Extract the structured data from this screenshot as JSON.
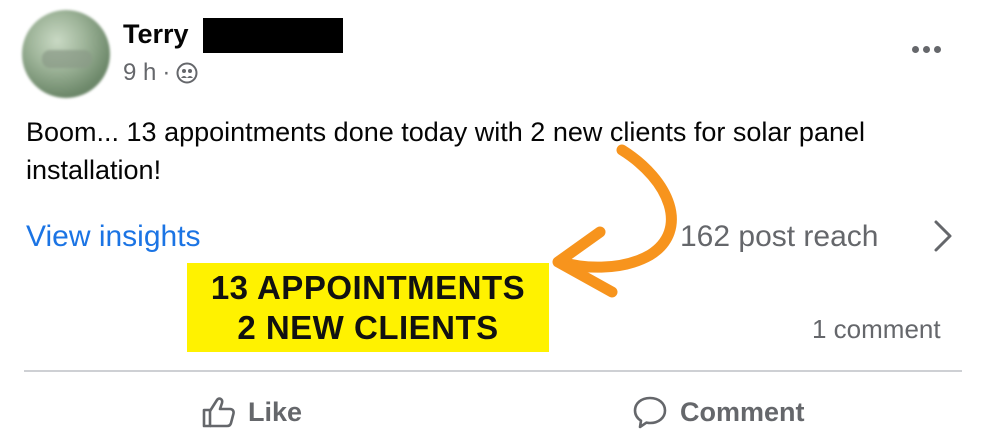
{
  "post": {
    "author_name": "Terry",
    "time": "9 h",
    "separator": "·",
    "visibility_icon": "friends-icon",
    "more_icon": "more-options-icon",
    "text": "Boom... 13 appointments done today with 2 new clients for solar panel installation!"
  },
  "insights": {
    "link_label": "View insights",
    "reach_label": "162 post reach"
  },
  "overlay": {
    "line1": "13 APPOINTMENTS",
    "line2": "2 NEW CLIENTS",
    "highlight_color": "#fff200",
    "arrow_color": "#f7941d"
  },
  "engagement": {
    "comment_count": "1 comment"
  },
  "actions": {
    "like_label": "Like",
    "comment_label": "Comment"
  },
  "colors": {
    "link": "#1b74e4",
    "secondary_text": "#65676b"
  }
}
